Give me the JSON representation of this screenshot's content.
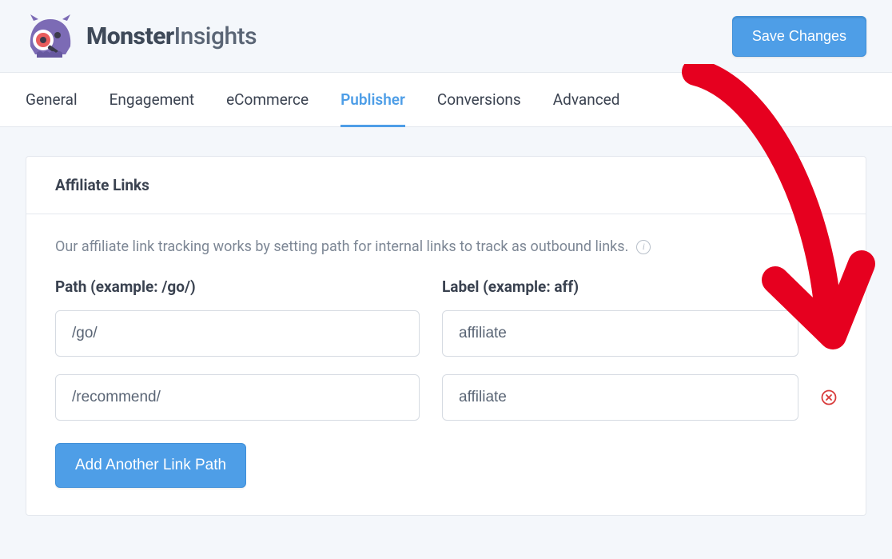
{
  "header": {
    "brand_bold": "Monster",
    "brand_light": "Insights",
    "save_label": "Save Changes"
  },
  "tabs": [
    {
      "label": "General",
      "active": false
    },
    {
      "label": "Engagement",
      "active": false
    },
    {
      "label": "eCommerce",
      "active": false
    },
    {
      "label": "Publisher",
      "active": true
    },
    {
      "label": "Conversions",
      "active": false
    },
    {
      "label": "Advanced",
      "active": false
    }
  ],
  "panel": {
    "title": "Affiliate Links",
    "description": "Our affiliate link tracking works by setting path for internal links to track as outbound links.",
    "path_header": "Path (example: /go/)",
    "label_header": "Label (example: aff)",
    "rows": [
      {
        "path": "/go/",
        "label": "affiliate"
      },
      {
        "path": "/recommend/",
        "label": "affiliate"
      }
    ],
    "add_button": "Add Another Link Path"
  }
}
